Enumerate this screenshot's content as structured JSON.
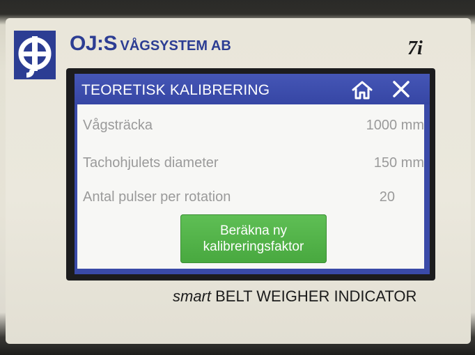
{
  "brand": {
    "name_part1": "OJ:S",
    "name_part2": "VÅGSYSTEM AB",
    "model": "7i",
    "logo_icon": "oj-logo-icon",
    "primary_color": "#2c3d93"
  },
  "screen": {
    "title": "TEORETISK KALIBRERING",
    "home_icon": "home-icon",
    "close_icon": "close-icon",
    "rows": [
      {
        "label": "Vågsträcka",
        "value": "1000 mm"
      },
      {
        "label": "Tachohjulets diameter",
        "value": "150 mm"
      },
      {
        "label": "Antal pulser per rotation",
        "value": "20"
      }
    ],
    "calc_button": {
      "line1": "Beräkna ny",
      "line2": "kalibreringsfaktor",
      "color": "#48a83f"
    }
  },
  "footer": {
    "italic_part": "smart",
    "rest": "BELT WEIGHER INDICATOR"
  }
}
